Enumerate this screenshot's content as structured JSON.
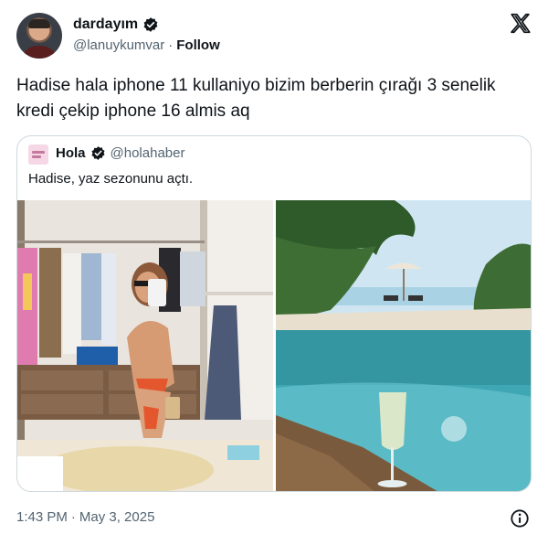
{
  "author": {
    "display_name": "dardayım",
    "handle": "@lanuykumvar",
    "separator": "·",
    "follow_label": "Follow",
    "verified_icon": "verified-badge-icon"
  },
  "tweet": {
    "text": "Hadise hala iphone 11 kullaniyo bizim berberin çırağı 3 senelik kredi çekip iphone 16 almis aq"
  },
  "quoted": {
    "display_name": "Hola",
    "handle": "@holahaber",
    "text": "Hadise, yaz sezonunu açtı.",
    "images": [
      "mirror-selfie-photo",
      "pool-beach-photo"
    ]
  },
  "footer": {
    "time": "1:43 PM",
    "separator": "·",
    "date": "May 3, 2025"
  },
  "icons": {
    "brand": "x-logo-icon",
    "info": "info-icon"
  },
  "colors": {
    "text": "#0f1419",
    "secondary": "#536471",
    "border": "#cfd9de",
    "verified": "#0f1419"
  }
}
